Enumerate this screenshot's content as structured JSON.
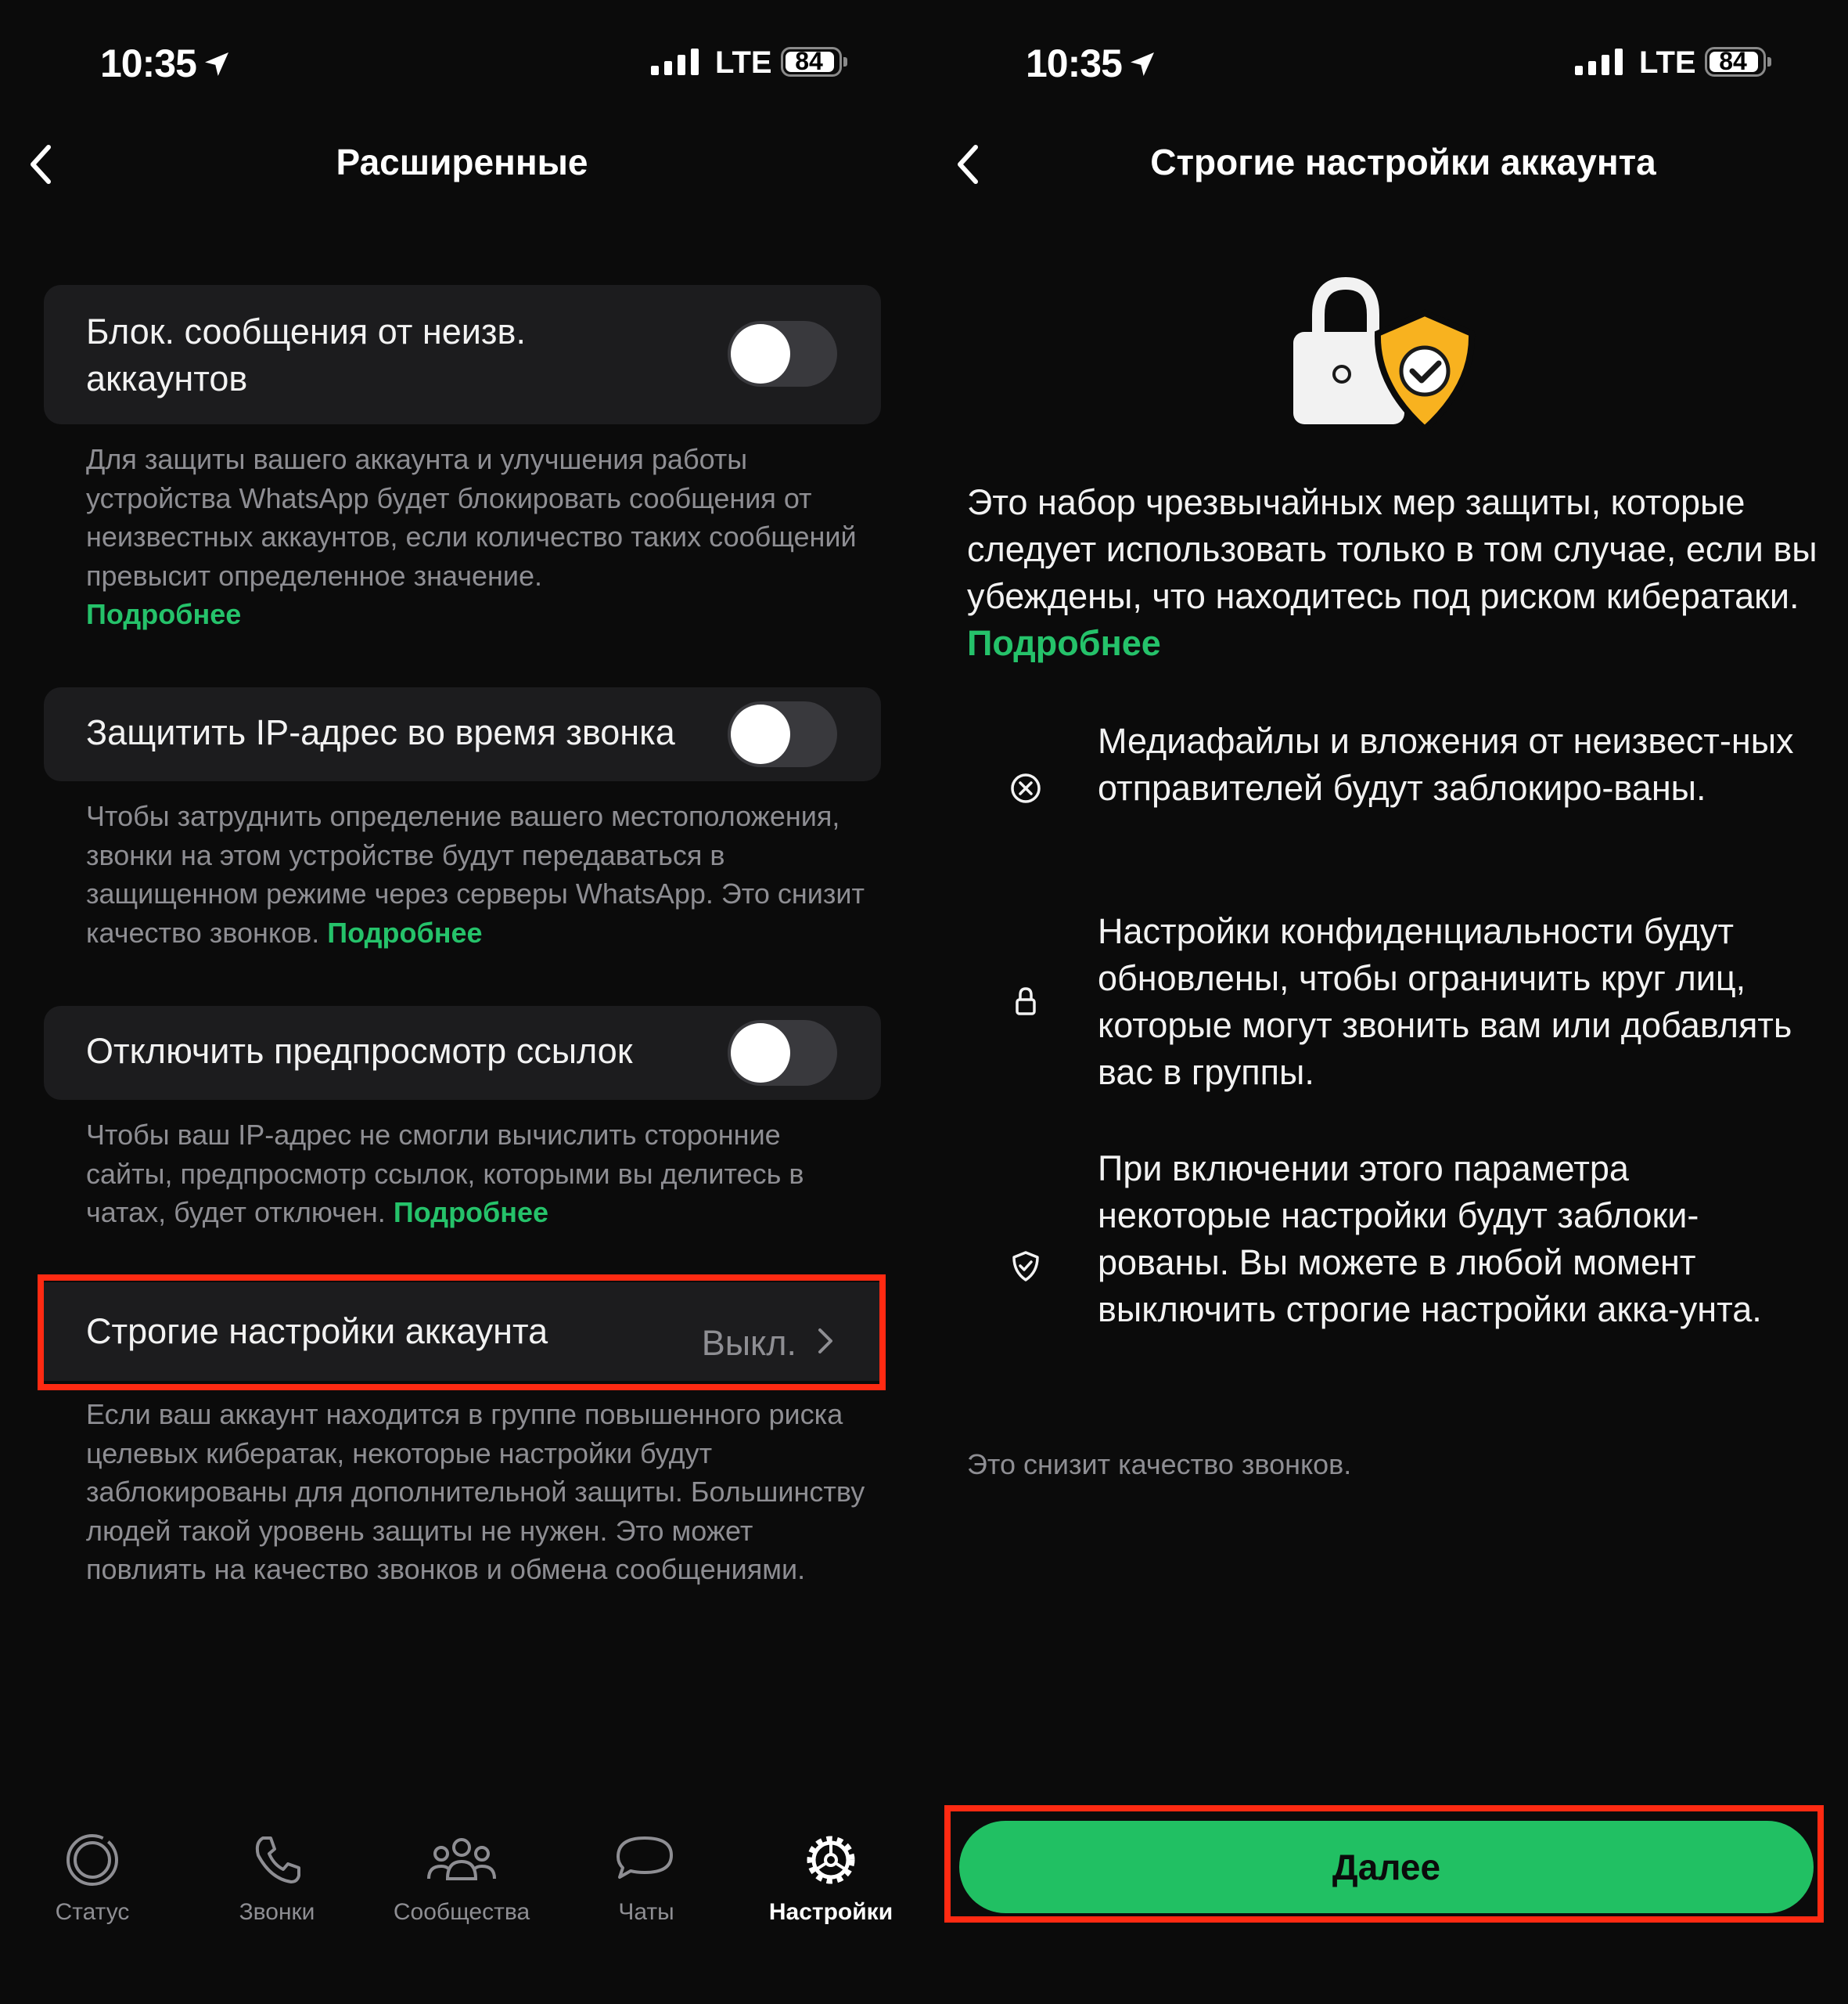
{
  "status_bar": {
    "time": "10:35",
    "network": "LTE",
    "battery": "84"
  },
  "colors": {
    "accent": "#25c26a",
    "button": "#21c063",
    "highlight": "#ff2a12",
    "background": "#0b0b0b",
    "card": "#1c1c1e"
  },
  "left": {
    "title": "Расширенные",
    "settings": [
      {
        "label_line1": "Блок. сообщения от неизв.",
        "label_line2": "аккаунтов",
        "toggle_on": false,
        "description": "Для защиты вашего аккаунта и улучшения работы устройства WhatsApp будет блокировать сообщения от неизвестных аккаунтов, если количество таких сообщений превысит определенное значение.",
        "link": "Подробнее"
      },
      {
        "label": "Защитить IP-адрес во время звонка",
        "toggle_on": false,
        "description": "Чтобы затруднить определение вашего местоположения, звонки на этом устройстве будут передаваться в защищенном режиме через серверы WhatsApp. Это снизит качество звонков.",
        "link": "Подробнее"
      },
      {
        "label": "Отключить предпросмотр ссылок",
        "toggle_on": false,
        "description": "Чтобы ваш IP-адрес не смогли вычислить сторонние сайты, предпросмотр ссылок, которыми вы делитесь в чатах, будет отключен.",
        "link": "Подробнее"
      },
      {
        "label": "Строгие настройки аккаунта",
        "value": "Выкл.",
        "description": "Если ваш аккаунт находится в группе повышенного риска целевых кибератак, некоторые настройки будут заблокированы для дополнительной защиты. Большинству людей такой уровень защиты не нужен. Это может повлиять на качество звонков и обмена сообщениями."
      }
    ],
    "tabs": [
      {
        "label": "Статус",
        "icon": "status-icon"
      },
      {
        "label": "Звонки",
        "icon": "phone-icon"
      },
      {
        "label": "Сообщества",
        "icon": "communities-icon"
      },
      {
        "label": "Чаты",
        "icon": "chat-bubbles-icon"
      },
      {
        "label": "Настройки",
        "icon": "gear-icon",
        "active": true
      }
    ]
  },
  "right": {
    "title": "Строгие настройки аккаунта",
    "intro": "Это набор чрезвычайных мер защиты, которые следует использовать только в том случае, если вы убеждены, что находитесь под риском кибератаки.",
    "intro_link": "Подробнее",
    "bullets": [
      {
        "icon": "x-circle-icon",
        "text": "Медиафайлы и вложения от неизвест-ных отправителей будут заблокиро-ваны."
      },
      {
        "icon": "lock-icon",
        "text": "Настройки конфиденциальности будут обновлены, чтобы ограничить круг лиц, которые могут звонить вам или добавлять вас в группы."
      },
      {
        "icon": "shield-check-icon",
        "text": "При включении этого параметра некоторые настройки будут заблоки-рованы. Вы можете в любой момент выключить строгие настройки акка-унта."
      }
    ],
    "footnote": "Это снизит качество звонков.",
    "button": "Далее"
  }
}
